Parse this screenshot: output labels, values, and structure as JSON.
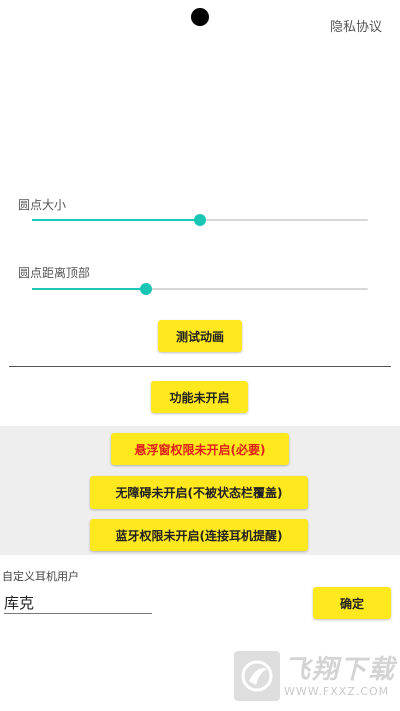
{
  "header": {
    "privacy_label": "隐私协议"
  },
  "dot_size": {
    "label": "圆点大小",
    "level_percent": 50
  },
  "dot_top_distance": {
    "label": "圆点距离顶部",
    "level_percent": 34
  },
  "test_animation_button": "测试动画",
  "function_status_button": "功能未开启",
  "permissions": {
    "float_window_button": "悬浮窗权限未开启(必要)",
    "accessibility_button": "无障碍未开启(不被状态栏覆盖)",
    "bluetooth_button": "蓝牙权限未开启(连接耳机提醒)"
  },
  "custom_user": {
    "label": "自定义耳机用户",
    "value": "库克",
    "confirm_button": "确定"
  },
  "watermark": {
    "title": "飞翔下载",
    "url": "WWW.FXXZ.COM"
  },
  "colors": {
    "accent": "#1fc7b6",
    "button": "#ffe81e",
    "warning_text": "#e0201b"
  }
}
